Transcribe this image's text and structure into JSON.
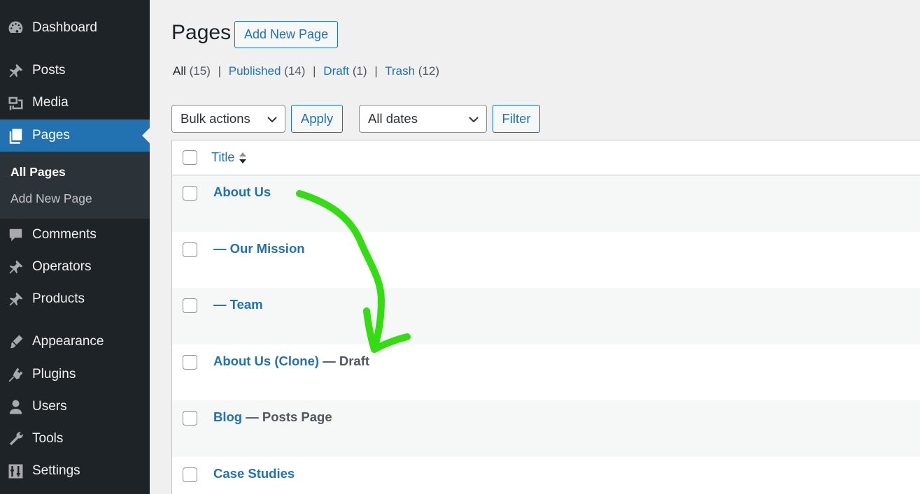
{
  "sidebar": {
    "items": [
      {
        "label": "Dashboard",
        "icon": "dashboard-icon"
      },
      {
        "label": "Posts",
        "icon": "pin-icon"
      },
      {
        "label": "Media",
        "icon": "media-icon"
      },
      {
        "label": "Pages",
        "icon": "pages-icon",
        "current": true
      },
      {
        "label": "Comments",
        "icon": "comment-icon"
      },
      {
        "label": "Operators",
        "icon": "pin-icon"
      },
      {
        "label": "Products",
        "icon": "pin-icon"
      },
      {
        "label": "Appearance",
        "icon": "brush-icon"
      },
      {
        "label": "Plugins",
        "icon": "plug-icon"
      },
      {
        "label": "Users",
        "icon": "user-icon"
      },
      {
        "label": "Tools",
        "icon": "wrench-icon"
      },
      {
        "label": "Settings",
        "icon": "settings-icon"
      }
    ],
    "submenu": [
      {
        "label": "All Pages",
        "current": true
      },
      {
        "label": "Add New Page"
      }
    ]
  },
  "header": {
    "title": "Pages",
    "add_new_label": "Add New Page"
  },
  "filters": {
    "all_label": "All",
    "all_count": "(15)",
    "published_label": "Published",
    "published_count": "(14)",
    "draft_label": "Draft",
    "draft_count": "(1)",
    "trash_label": "Trash",
    "trash_count": "(12)",
    "separator": "|"
  },
  "toolbar": {
    "bulk_actions": "Bulk actions",
    "apply_label": "Apply",
    "dates": "All dates",
    "filter_label": "Filter"
  },
  "table": {
    "title_header": "Title",
    "rows": [
      {
        "title": "About Us",
        "state": ""
      },
      {
        "title": "— Our Mission",
        "state": ""
      },
      {
        "title": "— Team",
        "state": ""
      },
      {
        "title": "About Us (Clone)",
        "state": " — Draft"
      },
      {
        "title": "Blog",
        "state": " — Posts Page"
      },
      {
        "title": "Case Studies",
        "state": ""
      }
    ]
  },
  "colors": {
    "sidebar_bg": "#1d2327",
    "accent": "#2271b1",
    "annotation_arrow": "#33dd11"
  }
}
